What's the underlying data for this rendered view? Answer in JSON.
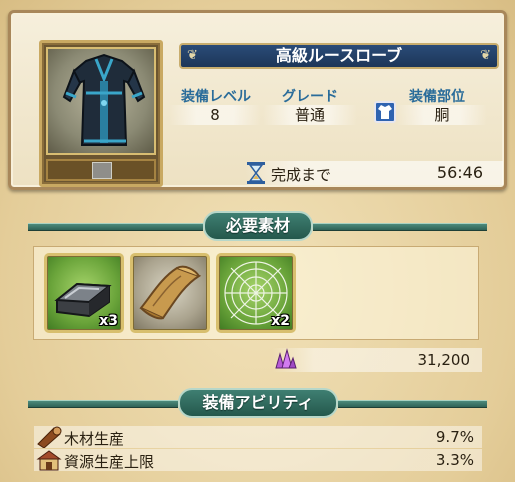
{
  "item": {
    "name": "高級ルースローブ",
    "stats": [
      {
        "label": "装備レベル",
        "value": "8"
      },
      {
        "label": "グレード",
        "value": "普通"
      },
      {
        "label": "装備部位",
        "value": "胴"
      }
    ],
    "timer_label": "完成まで",
    "timer_value": "56:46"
  },
  "materials_section": {
    "title": "必要素材",
    "materials": [
      {
        "icon": "iron-ingot-icon",
        "count": "x3"
      },
      {
        "icon": "parchment-scroll-icon",
        "count": ""
      },
      {
        "icon": "spider-web-icon",
        "count": "x2"
      }
    ],
    "cost_icon": "crystal-icon",
    "cost_value": "31,200"
  },
  "abilities_section": {
    "title": "装備アビリティ",
    "abilities": [
      {
        "icon": "wood-log-icon",
        "label": "木材生産",
        "value": "9.7%"
      },
      {
        "icon": "warehouse-icon",
        "label": "資源生産上限",
        "value": "3.3%"
      }
    ]
  },
  "colors": {
    "title_bar": "#1d3658",
    "stat_label": "#2a6c9a",
    "section_badge": "#2f6256",
    "background": "#e9d6a9"
  }
}
